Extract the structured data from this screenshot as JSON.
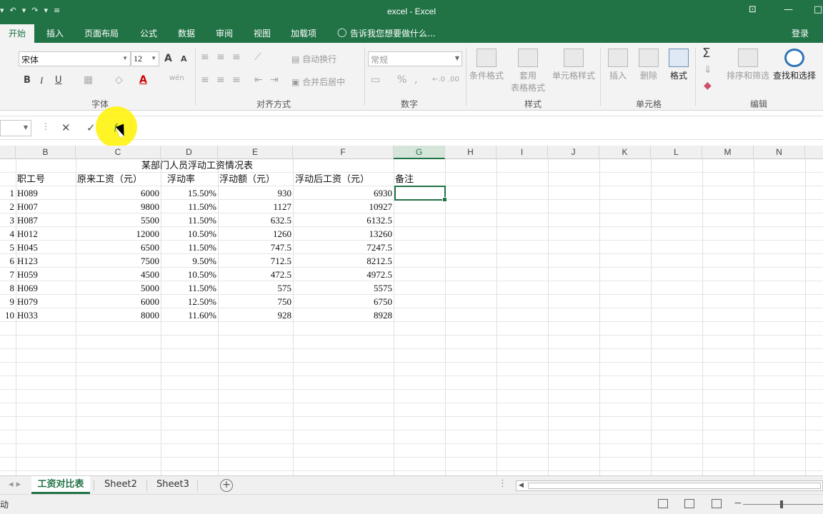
{
  "window": {
    "title": "excel - Excel",
    "qat": [
      "▾",
      "↶",
      "▾",
      "↷",
      "▾",
      "≡"
    ],
    "controls": {
      "ribbon_display": "⊡",
      "minimize": "—",
      "maximize": "□"
    }
  },
  "ribbon_tabs": [
    "开始",
    "插入",
    "页面布局",
    "公式",
    "数据",
    "审阅",
    "视图",
    "加载项"
  ],
  "tell_me": "告诉我您想要做什么...",
  "login": "登录",
  "ribbon": {
    "font_name": "宋体",
    "font_size": "12",
    "number_format": "常规",
    "wrap_text": "自动换行",
    "merge_center": "合并后居中",
    "cond_format": "条件格式",
    "table_format_1": "套用",
    "table_format_2": "表格格式",
    "cell_styles": "单元格样式",
    "insert": "插入",
    "delete": "删除",
    "format": "格式",
    "sort_filter": "排序和筛选",
    "find_select": "查找和选择",
    "bold": "B",
    "italic": "I",
    "underline": "U",
    "grow_font": "A",
    "shrink_font": "A",
    "wen": "wén",
    "percent": "%",
    "comma": ",",
    "dec_inc": "←.0",
    "dec_dec": ".00",
    "autosum": "Σ",
    "groups": {
      "font": "字体",
      "alignment": "对齐方式",
      "number": "数字",
      "styles": "样式",
      "cells": "单元格",
      "editing": "编辑"
    }
  },
  "formula_bar": {
    "cancel": "✕",
    "enter": "✓",
    "fx": "f"
  },
  "columns": [
    "B",
    "C",
    "D",
    "E",
    "F",
    "G",
    "H",
    "I",
    "J",
    "K",
    "L",
    "M",
    "N"
  ],
  "selected_column": "G",
  "sheet": {
    "title": "某部门人员浮动工资情况表",
    "headers": [
      "职工号",
      "原来工资（元）",
      "浮动率",
      "浮动额（元）",
      "浮动后工资（元）",
      "备注"
    ],
    "rows": [
      {
        "n": "1",
        "id": "H089",
        "salary": "6000",
        "rate": "15.50%",
        "amount": "930",
        "after": "6930"
      },
      {
        "n": "2",
        "id": "H007",
        "salary": "9800",
        "rate": "11.50%",
        "amount": "1127",
        "after": "10927"
      },
      {
        "n": "3",
        "id": "H087",
        "salary": "5500",
        "rate": "11.50%",
        "amount": "632.5",
        "after": "6132.5"
      },
      {
        "n": "4",
        "id": "H012",
        "salary": "12000",
        "rate": "10.50%",
        "amount": "1260",
        "after": "13260"
      },
      {
        "n": "5",
        "id": "H045",
        "salary": "6500",
        "rate": "11.50%",
        "amount": "747.5",
        "after": "7247.5"
      },
      {
        "n": "6",
        "id": "H123",
        "salary": "7500",
        "rate": "9.50%",
        "amount": "712.5",
        "after": "8212.5"
      },
      {
        "n": "7",
        "id": "H059",
        "salary": "4500",
        "rate": "10.50%",
        "amount": "472.5",
        "after": "4972.5"
      },
      {
        "n": "8",
        "id": "H069",
        "salary": "5000",
        "rate": "11.50%",
        "amount": "575",
        "after": "5575"
      },
      {
        "n": "9",
        "id": "H079",
        "salary": "6000",
        "rate": "12.50%",
        "amount": "750",
        "after": "6750"
      },
      {
        "n": "10",
        "id": "H033",
        "salary": "8000",
        "rate": "11.60%",
        "amount": "928",
        "after": "8928"
      }
    ]
  },
  "sheet_tabs": [
    "工资对比表",
    "Sheet2",
    "Sheet3"
  ],
  "add_sheet": "+",
  "status": "动",
  "colors": {
    "accent": "#217346",
    "selected_header": "#d6e5d9"
  }
}
